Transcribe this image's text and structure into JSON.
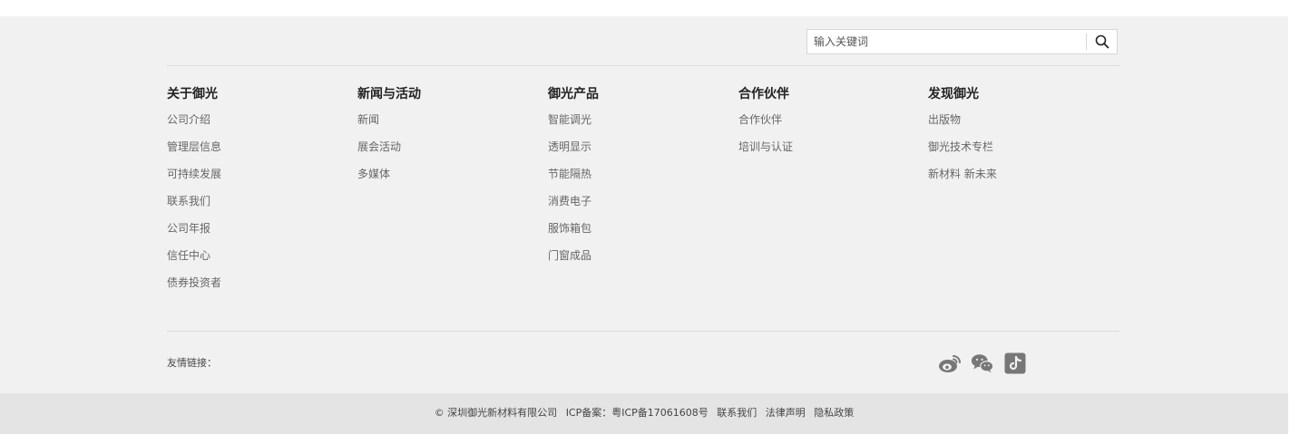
{
  "search": {
    "placeholder": "输入关键词",
    "value": ""
  },
  "columns": [
    {
      "title": "关于御光",
      "links": [
        "公司介绍",
        "管理层信息",
        "可持续发展",
        "联系我们",
        "公司年报",
        "信任中心",
        "债券投资者"
      ]
    },
    {
      "title": "新闻与活动",
      "links": [
        "新闻",
        "展会活动",
        "多媒体"
      ]
    },
    {
      "title": "御光产品",
      "links": [
        "智能调光",
        "透明显示",
        "节能隔热",
        "消费电子",
        "服饰箱包",
        "门窗成品"
      ]
    },
    {
      "title": "合作伙伴",
      "links": [
        "合作伙伴",
        "培训与认证"
      ]
    },
    {
      "title": "发现御光",
      "links": [
        "出版物",
        "御光技术专栏",
        "新材料 新未来"
      ]
    }
  ],
  "friend_links_label": "友情链接：",
  "social": {
    "icons": [
      "weibo-icon",
      "wechat-icon",
      "douyin-icon"
    ],
    "color": "#777777"
  },
  "bottom_bar": {
    "copyright": "© 深圳御光新材料有限公司",
    "icp": "ICP备案：粤ICP备17061608号",
    "contact": "联系我们",
    "legal": "法律声明",
    "privacy": "隐私政策"
  },
  "colors": {
    "footer_bg": "#f1f1f1",
    "bottom_bg": "#e4e4e4",
    "text": "#666666",
    "title": "#222222"
  }
}
